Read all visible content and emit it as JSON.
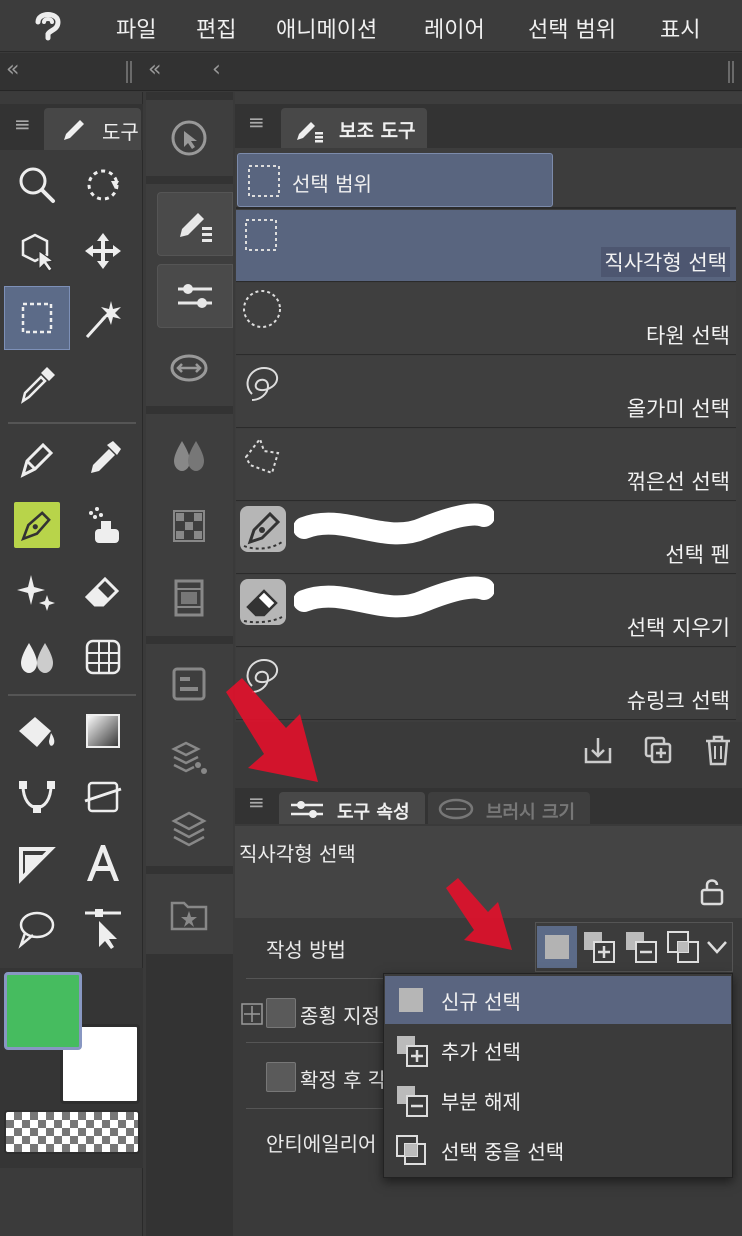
{
  "menubar": {
    "items": [
      "파일",
      "편집",
      "애니메이션",
      "레이어",
      "선택 범위",
      "표시"
    ]
  },
  "collapsebar": {
    "glyph_left": "«",
    "glyph_mid": "«",
    "glyph_right": "‹"
  },
  "tool_panel": {
    "tab_label": "도구",
    "menu_glyph": "≡"
  },
  "subtool_panel": {
    "tab_label": "보조 도구",
    "menu_glyph": "≡",
    "group_label": "선택 범위",
    "items": [
      {
        "label": "직사각형 선택",
        "selected": true
      },
      {
        "label": "타원 선택",
        "selected": false
      },
      {
        "label": "올가미 선택",
        "selected": false
      },
      {
        "label": "꺾은선 선택",
        "selected": false
      },
      {
        "label": "선택 펜",
        "selected": false
      },
      {
        "label": "선택 지우기",
        "selected": false
      },
      {
        "label": "슈링크 선택",
        "selected": false
      }
    ]
  },
  "property_panel": {
    "menu_glyph": "≡",
    "tab_label": "도구 속성",
    "tab2_label": "브러시 크기",
    "tool_name": "직사각형 선택",
    "rows": {
      "creation_method": "작성 방법",
      "aspect": "종횡 지정",
      "after_confirm": "확정 후 각",
      "antialias": "안티에일리어"
    }
  },
  "mode_dropdown": {
    "items": [
      {
        "label": "신규 선택",
        "selected": true
      },
      {
        "label": "추가 선택",
        "selected": false
      },
      {
        "label": "부분 해제",
        "selected": false
      },
      {
        "label": "선택 중을 선택",
        "selected": false
      }
    ]
  },
  "colors": {
    "main": "#46bc5f",
    "sub": "#ffffff",
    "accent": "#5c6b88",
    "arrow": "#e0112b"
  }
}
